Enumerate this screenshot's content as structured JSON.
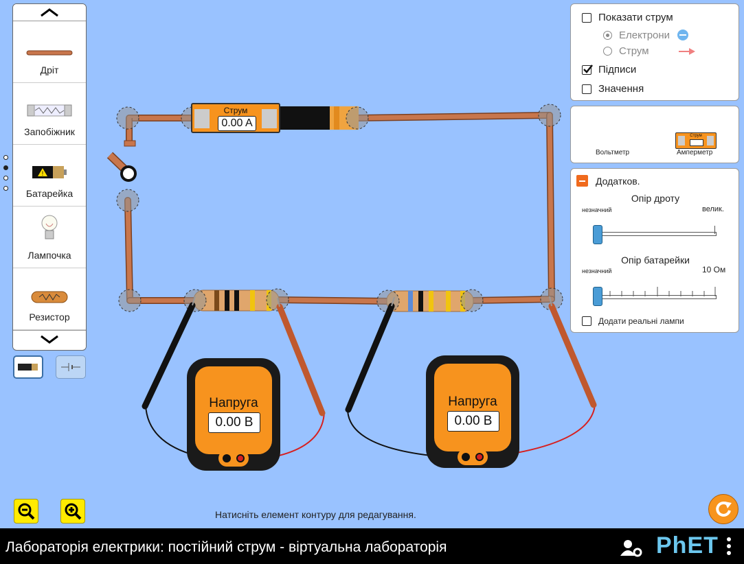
{
  "toolbox": {
    "items": [
      {
        "label": "Дріт"
      },
      {
        "label": "Запобіжник"
      },
      {
        "label": "Батарейка"
      },
      {
        "label": "Лампочка"
      },
      {
        "label": "Резистор"
      }
    ]
  },
  "ammeter": {
    "title": "Струм",
    "value": "0.00 A"
  },
  "voltmeters": [
    {
      "title": "Напруга",
      "value": "0.00 В"
    },
    {
      "title": "Напруга",
      "value": "0.00 В"
    }
  ],
  "view_panel": {
    "show_current": "Показати струм",
    "electrons": "Електрони",
    "conventional": "Струм",
    "labels": "Підписи",
    "values": "Значення"
  },
  "sensors_panel": {
    "voltmeter": "Вольтметр",
    "ammeter": "Амперметр",
    "ammeter_mini_label": "Струм"
  },
  "advanced_panel": {
    "title": "Додатков.",
    "wire_resistance": "Опір дроту",
    "wire_min": "незначний",
    "wire_max": "велик.",
    "battery_resistance": "Опір батарейки",
    "battery_min": "незначний",
    "battery_max": "10 Ом",
    "real_bulbs": "Додати реальні лампи"
  },
  "hint": "Натисніть елемент контуру для редагування.",
  "footer": {
    "title": "Лабораторія електрики: постійний струм - віртуальна лабораторія",
    "logo": "PhET"
  },
  "colors": {
    "background": "#99c2ff",
    "meter_orange": "#f7931e",
    "wire": "#c8764c"
  }
}
